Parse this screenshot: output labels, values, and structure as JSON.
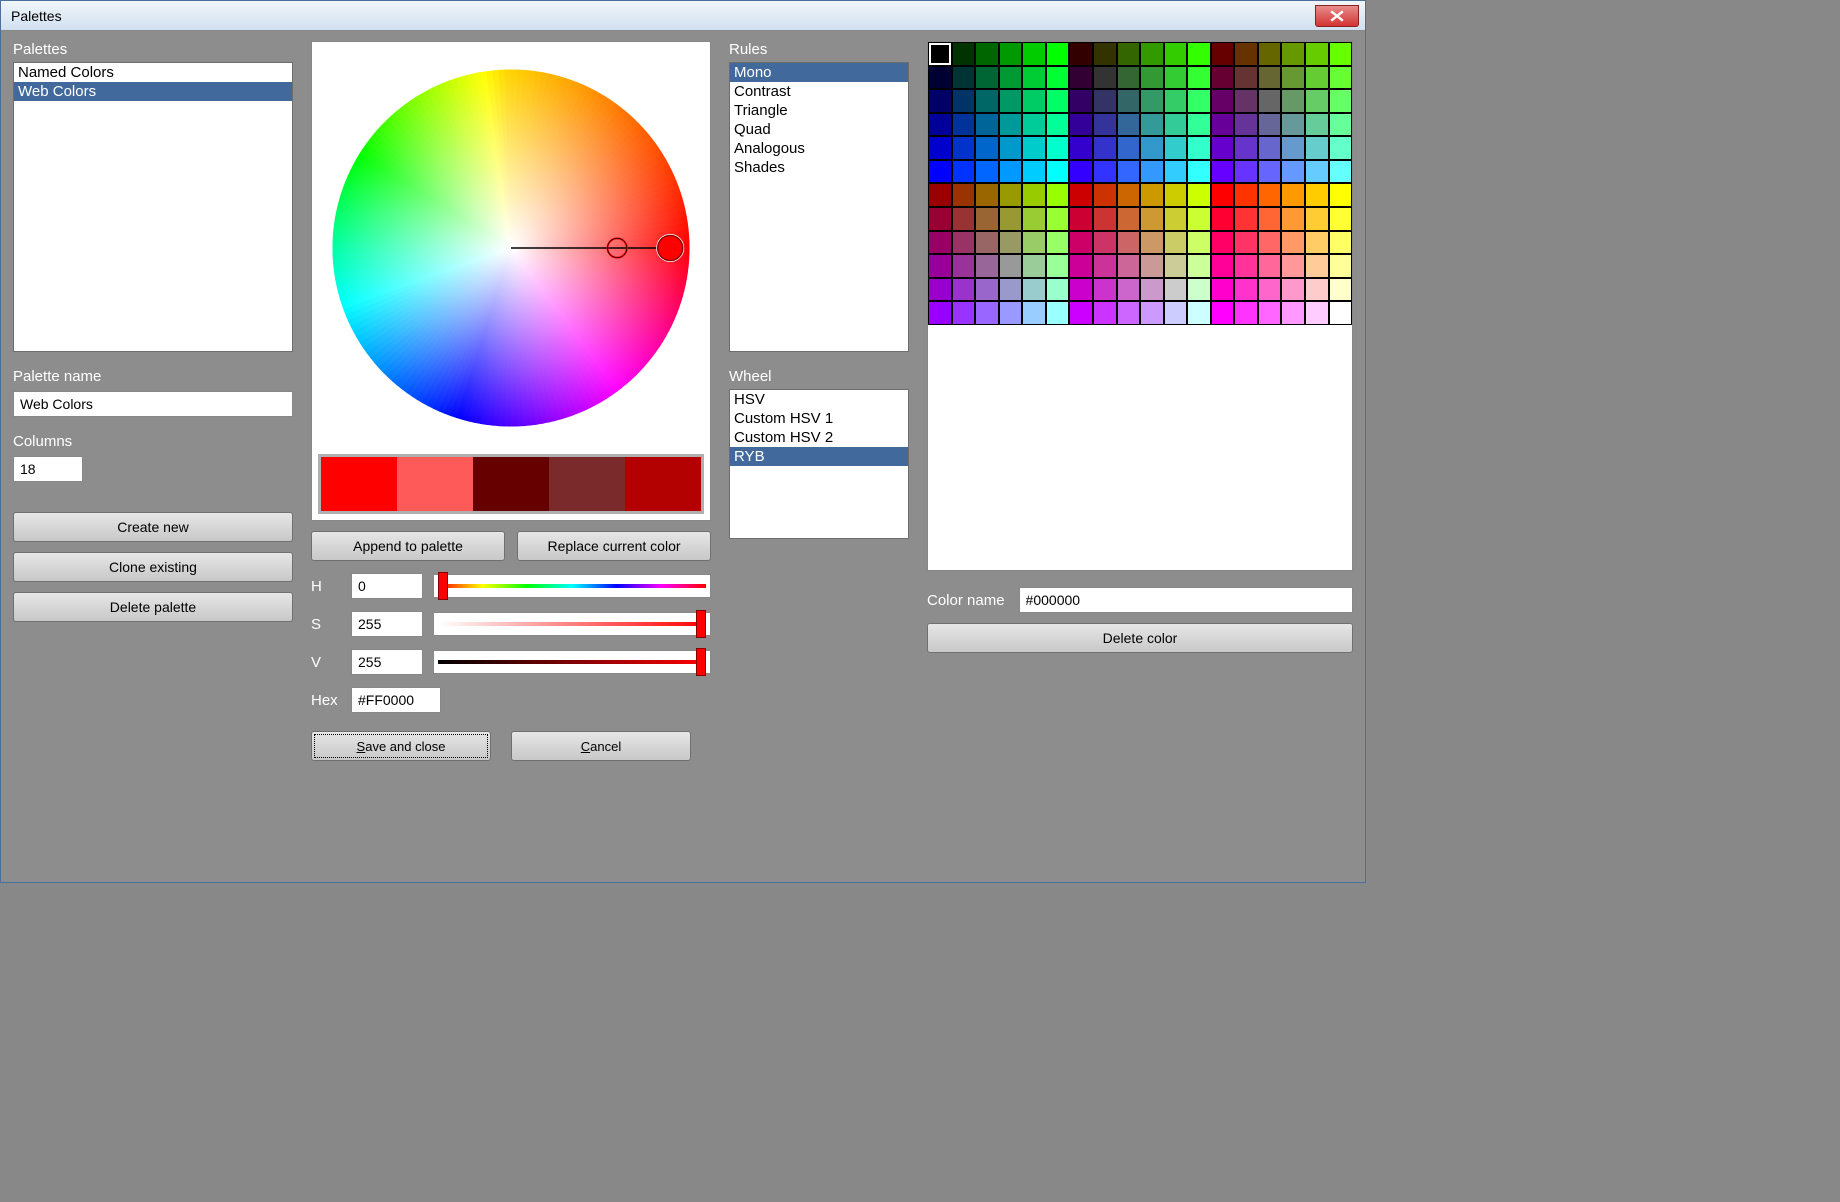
{
  "window": {
    "title": "Palettes"
  },
  "palettes": {
    "label": "Palettes",
    "items": [
      "Named Colors",
      "Web Colors"
    ],
    "selected_index": 1,
    "name_label": "Palette name",
    "name_value": "Web Colors",
    "columns_label": "Columns",
    "columns_value": "18",
    "create_label": "Create new",
    "clone_label": "Clone existing",
    "delete_label": "Delete palette"
  },
  "picker": {
    "strip_colors": [
      "#ff0000",
      "#ff5a5a",
      "#660000",
      "#7a2a2a",
      "#b30000"
    ],
    "strip_selected": 0,
    "append_label": "Append to palette",
    "replace_label": "Replace current color",
    "h_label": "H",
    "h_value": "0",
    "s_label": "S",
    "s_value": "255",
    "v_label": "V",
    "v_value": "255",
    "hex_label": "Hex",
    "hex_value": "#FF0000",
    "save_label": "Save and close",
    "cancel_label": "Cancel"
  },
  "rules": {
    "label": "Rules",
    "items": [
      "Mono",
      "Contrast",
      "Triangle",
      "Quad",
      "Analogous",
      "Shades"
    ],
    "selected_index": 0
  },
  "wheel": {
    "label": "Wheel",
    "items": [
      "HSV",
      "Custom HSV 1",
      "Custom HSV 2",
      "RYB"
    ],
    "selected_index": 3
  },
  "color_panel": {
    "name_label": "Color name",
    "name_value": "#000000",
    "delete_label": "Delete color",
    "selected_index": 0,
    "swatches": [
      "#000000",
      "#003300",
      "#006600",
      "#009900",
      "#00cc00",
      "#00ff00",
      "#330000",
      "#333300",
      "#336600",
      "#339900",
      "#33cc00",
      "#33ff00",
      "#660000",
      "#663300",
      "#666600",
      "#669900",
      "#66cc00",
      "#66ff00",
      "#000033",
      "#003333",
      "#006633",
      "#009933",
      "#00cc33",
      "#00ff33",
      "#330033",
      "#333333",
      "#336633",
      "#339933",
      "#33cc33",
      "#33ff33",
      "#660033",
      "#663333",
      "#666633",
      "#669933",
      "#66cc33",
      "#66ff33",
      "#000066",
      "#003366",
      "#006666",
      "#009966",
      "#00cc66",
      "#00ff66",
      "#330066",
      "#333366",
      "#336666",
      "#339966",
      "#33cc66",
      "#33ff66",
      "#660066",
      "#663366",
      "#666666",
      "#669966",
      "#66cc66",
      "#66ff66",
      "#000099",
      "#003399",
      "#006699",
      "#009999",
      "#00cc99",
      "#00ff99",
      "#330099",
      "#333399",
      "#336699",
      "#339999",
      "#33cc99",
      "#33ff99",
      "#660099",
      "#663399",
      "#666699",
      "#669999",
      "#66cc99",
      "#66ff99",
      "#0000cc",
      "#0033cc",
      "#0066cc",
      "#0099cc",
      "#00cccc",
      "#00ffcc",
      "#3300cc",
      "#3333cc",
      "#3366cc",
      "#3399cc",
      "#33cccc",
      "#33ffcc",
      "#6600cc",
      "#6633cc",
      "#6666cc",
      "#6699cc",
      "#66cccc",
      "#66ffcc",
      "#0000ff",
      "#0033ff",
      "#0066ff",
      "#0099ff",
      "#00ccff",
      "#00ffff",
      "#3300ff",
      "#3333ff",
      "#3366ff",
      "#3399ff",
      "#33ccff",
      "#33ffff",
      "#6600ff",
      "#6633ff",
      "#6666ff",
      "#6699ff",
      "#66ccff",
      "#66ffff",
      "#990000",
      "#993300",
      "#996600",
      "#999900",
      "#99cc00",
      "#99ff00",
      "#cc0000",
      "#cc3300",
      "#cc6600",
      "#cc9900",
      "#cccc00",
      "#ccff00",
      "#ff0000",
      "#ff3300",
      "#ff6600",
      "#ff9900",
      "#ffcc00",
      "#ffff00",
      "#990033",
      "#993333",
      "#996633",
      "#999933",
      "#99cc33",
      "#99ff33",
      "#cc0033",
      "#cc3333",
      "#cc6633",
      "#cc9933",
      "#cccc33",
      "#ccff33",
      "#ff0033",
      "#ff3333",
      "#ff6633",
      "#ff9933",
      "#ffcc33",
      "#ffff33",
      "#990066",
      "#993366",
      "#996666",
      "#999966",
      "#99cc66",
      "#99ff66",
      "#cc0066",
      "#cc3366",
      "#cc6666",
      "#cc9966",
      "#cccc66",
      "#ccff66",
      "#ff0066",
      "#ff3366",
      "#ff6666",
      "#ff9966",
      "#ffcc66",
      "#ffff66",
      "#990099",
      "#993399",
      "#996699",
      "#999999",
      "#99cc99",
      "#99ff99",
      "#cc0099",
      "#cc3399",
      "#cc6699",
      "#cc9999",
      "#cccc99",
      "#ccff99",
      "#ff0099",
      "#ff3399",
      "#ff6699",
      "#ff9999",
      "#ffcc99",
      "#ffff99",
      "#9900cc",
      "#9933cc",
      "#9966cc",
      "#9999cc",
      "#99cccc",
      "#99ffcc",
      "#cc00cc",
      "#cc33cc",
      "#cc66cc",
      "#cc99cc",
      "#cccccc",
      "#ccffcc",
      "#ff00cc",
      "#ff33cc",
      "#ff66cc",
      "#ff99cc",
      "#ffcccc",
      "#ffffcc",
      "#9900ff",
      "#9933ff",
      "#9966ff",
      "#9999ff",
      "#99ccff",
      "#99ffff",
      "#cc00ff",
      "#cc33ff",
      "#cc66ff",
      "#cc99ff",
      "#ccccff",
      "#ccffff",
      "#ff00ff",
      "#ff33ff",
      "#ff66ff",
      "#ff99ff",
      "#ffccff",
      "#ffffff"
    ]
  }
}
